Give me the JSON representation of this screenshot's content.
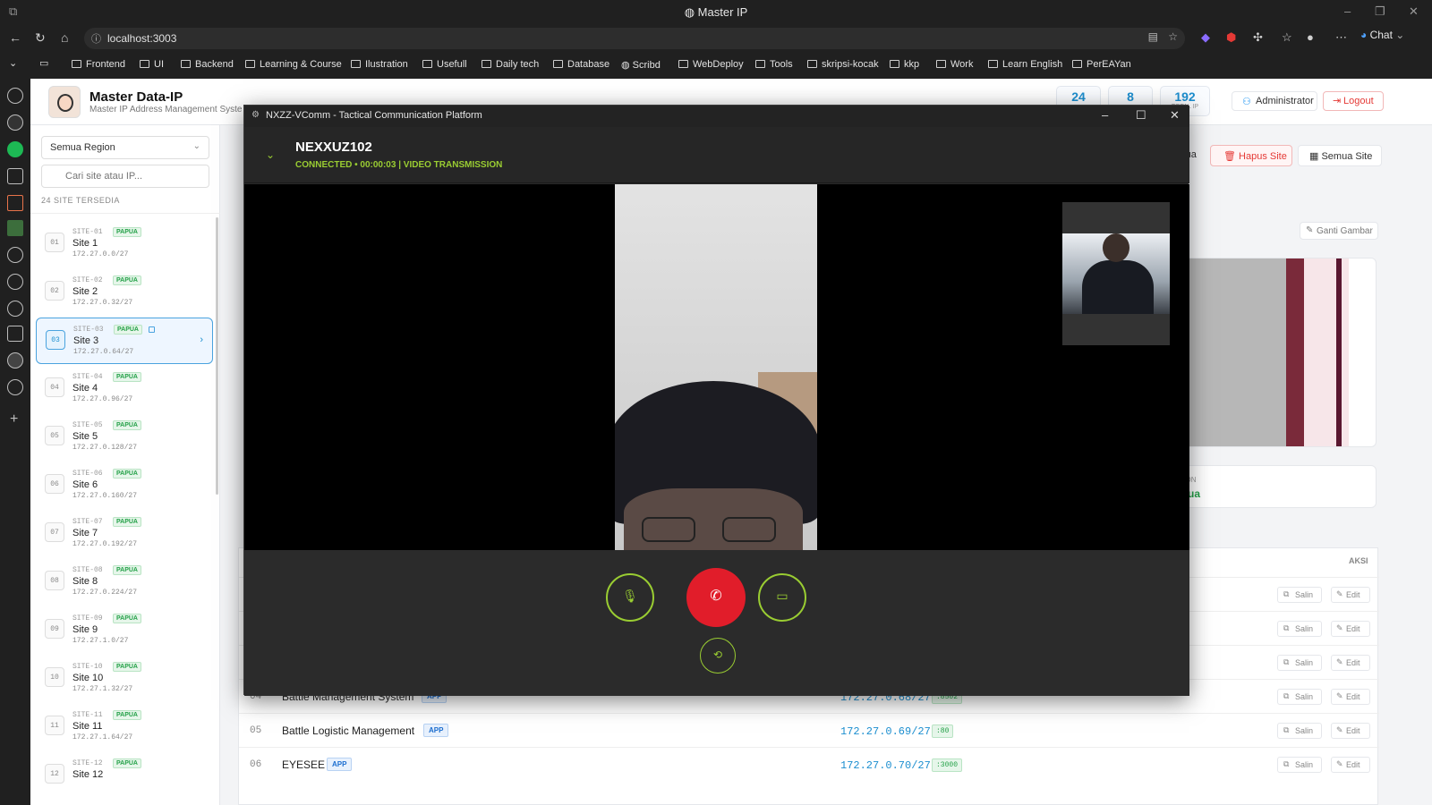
{
  "browser": {
    "window_title": "Master IP",
    "url": "localhost:3003",
    "chat_label": "Chat",
    "bookmarks": [
      "Frontend",
      "UI",
      "Backend",
      "Learning & Course",
      "Ilustration",
      "Usefull",
      "Daily tech",
      "Database",
      "Scribd",
      "WebDeploy",
      "Tools",
      "skripsi-kocak",
      "kkp",
      "Work",
      "Learn English",
      "PerEAYan"
    ]
  },
  "app": {
    "title": "Master Data-IP",
    "subtitle": "Master IP Address Management System",
    "stats": [
      {
        "value": "24",
        "label": ""
      },
      {
        "value": "8",
        "label": ""
      },
      {
        "value": "192",
        "label": "TOTAL IP"
      }
    ],
    "admin_label": "Administrator",
    "logout_label": "Logout"
  },
  "sidebar": {
    "region_select": "Semua Region",
    "search_placeholder": "Cari site atau IP...",
    "site_count": "24 SITE TERSEDIA",
    "sites": [
      {
        "num": "01",
        "code": "SITE-01",
        "region": "PAPUA",
        "name": "Site 1",
        "ip": "172.27.0.0/27"
      },
      {
        "num": "02",
        "code": "SITE-02",
        "region": "PAPUA",
        "name": "Site 2",
        "ip": "172.27.0.32/27"
      },
      {
        "num": "03",
        "code": "SITE-03",
        "region": "PAPUA",
        "name": "Site 3",
        "ip": "172.27.0.64/27"
      },
      {
        "num": "04",
        "code": "SITE-04",
        "region": "PAPUA",
        "name": "Site 4",
        "ip": "172.27.0.96/27"
      },
      {
        "num": "05",
        "code": "SITE-05",
        "region": "PAPUA",
        "name": "Site 5",
        "ip": "172.27.0.128/27"
      },
      {
        "num": "06",
        "code": "SITE-06",
        "region": "PAPUA",
        "name": "Site 6",
        "ip": "172.27.0.160/27"
      },
      {
        "num": "07",
        "code": "SITE-07",
        "region": "PAPUA",
        "name": "Site 7",
        "ip": "172.27.0.192/27"
      },
      {
        "num": "08",
        "code": "SITE-08",
        "region": "PAPUA",
        "name": "Site 8",
        "ip": "172.27.0.224/27"
      },
      {
        "num": "09",
        "code": "SITE-09",
        "region": "PAPUA",
        "name": "Site 9",
        "ip": "172.27.1.0/27"
      },
      {
        "num": "10",
        "code": "SITE-10",
        "region": "PAPUA",
        "name": "Site 10",
        "ip": "172.27.1.32/27"
      },
      {
        "num": "11",
        "code": "SITE-11",
        "region": "PAPUA",
        "name": "Site 11",
        "ip": "172.27.1.64/27"
      },
      {
        "num": "12",
        "code": "SITE-12",
        "region": "PAPUA",
        "name": "Site 12",
        "ip": ""
      }
    ]
  },
  "main": {
    "semua_label": "Semua",
    "hapus_label": "Hapus Site",
    "semua_site_label": "Semua Site",
    "ganti_label": "Ganti Gambar",
    "region_label": "REGION",
    "region_value": "Papua",
    "aksi_label": "AKSI",
    "salin_label": "Salin",
    "edit_label": "Edit",
    "rows": [
      {
        "no": "04",
        "name": "Battle Management System",
        "type": "APP",
        "ip": "172.27.0.68/27",
        "port": ":8502"
      },
      {
        "no": "05",
        "name": "Battle Logistic Management",
        "type": "APP",
        "ip": "172.27.0.69/27",
        "port": ":80"
      },
      {
        "no": "06",
        "name": "EYESEE",
        "type": "APP",
        "ip": "172.27.0.70/27",
        "port": ":3000"
      }
    ]
  },
  "call": {
    "window_title": "NXZZ-VComm - Tactical Communication Platform",
    "peer_name": "NEXXUZ102",
    "status": "CONNECTED • 00:00:03 | VIDEO TRANSMISSION"
  },
  "colors": {
    "accent": "#1d8fd0",
    "success": "#24a148",
    "danger": "#e11d2a",
    "call_accent": "#9acd32"
  }
}
